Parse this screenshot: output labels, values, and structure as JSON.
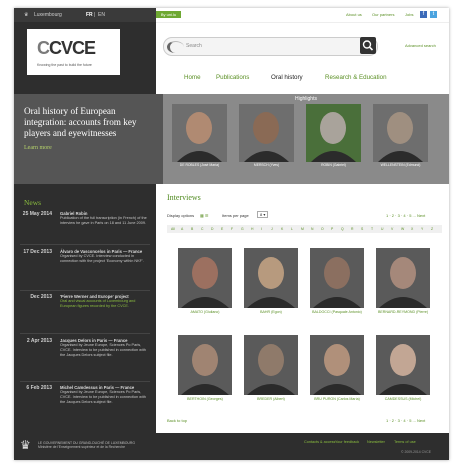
{
  "topbar": {
    "country": "Luxembourg",
    "lang_active": "FR",
    "lang_other": "EN",
    "badge": "By uni.lu",
    "links": [
      "About us",
      "Our partners",
      "Jobs"
    ],
    "facebook_label": "f",
    "twitter_label": "t"
  },
  "logo": {
    "mark_c": "C",
    "mark_rest": "CVCE",
    "tagline": "Knowing the past to build the future"
  },
  "search": {
    "placeholder": "Search",
    "advanced": "Advanced search"
  },
  "nav": [
    "Home",
    "Publications",
    "Oral history",
    "Research & Education"
  ],
  "hero": {
    "text": "Oral history of European integration: accounts from key players and eyewitnesses",
    "link": "Learn more"
  },
  "highlights": {
    "title": "Highlights",
    "people": [
      "DE ROBLES (José María)",
      "MERSCH (Yves)",
      "ROBIN (Gabriel)",
      "WELLENSTEIN (Edmund)"
    ],
    "colors": [
      "#b08a72",
      "#8a6a55",
      "#a9a39b",
      "#9f8f80"
    ]
  },
  "news": {
    "title": "News",
    "items": [
      {
        "date": "25 May 2014",
        "title": "Gabriel Robin",
        "body": "Publication of the full transcription (in French) of the interview he gave in Paris on 18 and 11 June 2009."
      },
      {
        "date": "17 Dec 2013",
        "title": "Álvaro de Vasconcelos in Paris — France",
        "body": "Organised by CVCE. Interview conducted in connection with the project 'Economy within NKF'."
      },
      {
        "date": "Dec 2013",
        "title": "'Pierre Werner and Europe' project",
        "body": "Oral and visual accounts of Luxembourg and European figures recorded by the CVCE."
      },
      {
        "date": "2 Apr 2013",
        "title": "Jacques Delors in Paris — France",
        "body": "Organised by Jeune Europe, Sciences Po Paris, CVCE. Interview to be published in connection with the Jacques Delors subject file."
      },
      {
        "date": "6 Feb 2013",
        "title": "Michel Camdessus in Paris — France",
        "body": "Organised by Jeune Europe, Sciences Po Paris, CVCE. Interview to be published in connection with the Jacques Delors subject file."
      }
    ]
  },
  "interviews": {
    "title": "Interviews",
    "display_options": "Display options",
    "items_per_page_label": "Items per page",
    "items_per_page_value": "8",
    "pagination": [
      "1",
      "2",
      "3",
      "4",
      "5",
      "...",
      "Next"
    ],
    "alphabet": [
      "All",
      "A",
      "B",
      "C",
      "D",
      "E",
      "F",
      "G",
      "H",
      "I",
      "J",
      "K",
      "L",
      "M",
      "N",
      "O",
      "P",
      "Q",
      "R",
      "S",
      "T",
      "U",
      "V",
      "W",
      "X",
      "Y",
      "Z"
    ],
    "people": [
      {
        "name": "AMATO (Giuliano)",
        "color": "#9c7060"
      },
      {
        "name": "BAHR (Egon)",
        "color": "#b79a7e"
      },
      {
        "name": "BALDOCCI (Pasquale Antonio)",
        "color": "#8b6f60"
      },
      {
        "name": "BERNARD-REYMOND (Pierre)",
        "color": "#a5887a"
      },
      {
        "name": "BERTHOIN (Georges)",
        "color": "#a08472"
      },
      {
        "name": "BREDER (Albert)",
        "color": "#8f7a6a"
      },
      {
        "name": "BRU PURON (Carlos María)",
        "color": "#b0907a"
      },
      {
        "name": "CAMDESSUS (Michel)",
        "color": "#c2a694"
      }
    ],
    "back_to_top": "Back to top"
  },
  "footer": {
    "org": "LE GOUVERNEMENT DU GRAND-DUCHÉ DE LUXEMBOURG Ministère de l'Enseignement supérieur et de la Recherche",
    "links": [
      "Contacts & access",
      "Your feedback",
      "Newsletter",
      "Terms of use"
    ],
    "copyright": "© 2009-2014 CVCE"
  }
}
